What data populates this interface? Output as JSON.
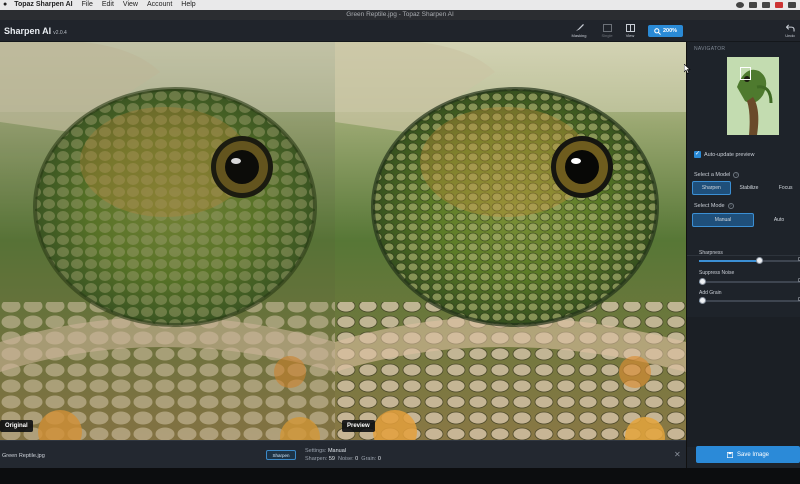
{
  "menubar": {
    "app_name": "Topaz Sharpen AI",
    "items": [
      "File",
      "Edit",
      "View",
      "Account",
      "Help"
    ]
  },
  "window_title": "Green Reptile.jpg - Topaz Sharpen AI",
  "toolbar": {
    "brand": "Sharpen AI",
    "version": "v2.0.4",
    "tools": [
      {
        "label": "Masking",
        "icon": "brush-icon"
      },
      {
        "label": "Single",
        "icon": "single-view-icon"
      },
      {
        "label": "View",
        "icon": "split-view-icon"
      }
    ],
    "zoom_label": "200%",
    "undo_label": "Undo"
  },
  "viewer": {
    "left_label": "Original",
    "right_label": "Preview"
  },
  "bottom": {
    "filename": "Green Reptile.jpg",
    "mode_badge": "Sharpen",
    "settings_key": "Settings:",
    "settings_value": "Manual",
    "sharpen_key": "Sharpen:",
    "sharpen_value": "59",
    "noise_key": "Noise:",
    "noise_value": "0",
    "grain_key": "Grain:",
    "grain_value": "0"
  },
  "panel": {
    "navigator_label": "NAVIGATOR",
    "auto_update_label": "Auto-update preview",
    "auto_update_checked": true,
    "model_label": "Select a Model",
    "models": [
      "Sharpen",
      "Stabilize",
      "Focus"
    ],
    "model_selected": "Sharpen",
    "mode_label": "Select Mode",
    "modes": [
      "Manual",
      "Auto"
    ],
    "mode_selected": "Manual",
    "sliders": [
      {
        "label": "Sharpness",
        "value": 0.59,
        "display": "0"
      },
      {
        "label": "Suppress Noise",
        "value": 0.0,
        "display": "0"
      },
      {
        "label": "Add Grain",
        "value": 0.0,
        "display": "0"
      }
    ],
    "save_label": "Save Image"
  },
  "colors": {
    "accent": "#2a8ad6",
    "panel_bg": "#1e232a",
    "toolbar_bg": "#20242b"
  }
}
